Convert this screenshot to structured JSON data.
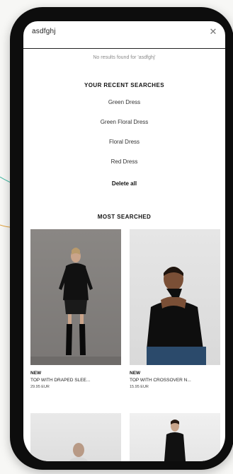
{
  "search": {
    "query": "asdfghj",
    "no_results": "No results found for 'asdfghj'"
  },
  "recent": {
    "title": "YOUR RECENT SEARCHES",
    "items": [
      "Green Dress",
      "Green Floral Dress",
      "Floral Dress",
      "Red Dress"
    ],
    "delete_all": "Delete all"
  },
  "most_searched": {
    "title": "MOST SEARCHED",
    "products": [
      {
        "badge": "NEW",
        "name": "TOP WITH DRAPED SLEE...",
        "price": "29.95 EUR"
      },
      {
        "badge": "NEW",
        "name": "TOP WITH CROSSOVER N...",
        "price": "15.95 EUR"
      }
    ]
  },
  "icons": {
    "clear": "close-icon"
  }
}
